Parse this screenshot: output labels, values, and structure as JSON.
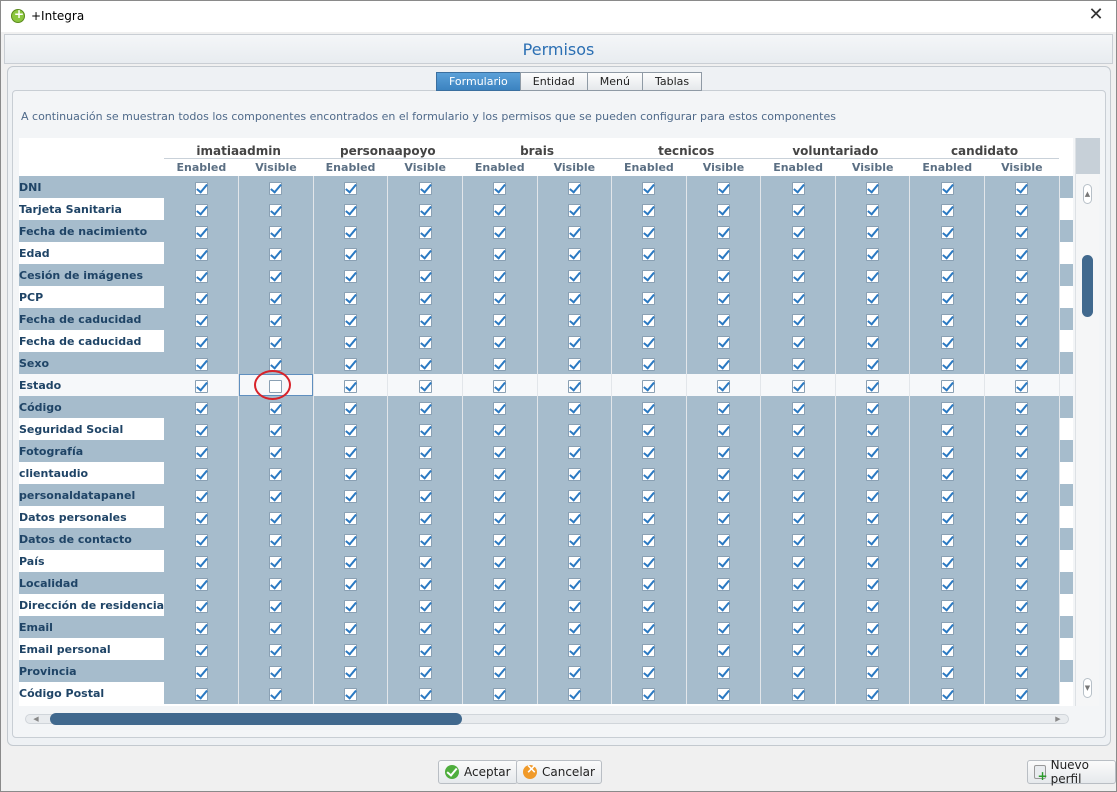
{
  "window": {
    "title": "+Integra",
    "close_glyph": "✕"
  },
  "page": {
    "title": "Permisos"
  },
  "tabs": [
    {
      "label": "Formulario",
      "active": true
    },
    {
      "label": "Entidad",
      "active": false
    },
    {
      "label": "Menú",
      "active": false
    },
    {
      "label": "Tablas",
      "active": false
    }
  ],
  "description": "A continuación se muestran todos los componentes encontrados en el formulario y los permisos que se pueden configurar para estos componentes",
  "permissions": {
    "sub_headers": [
      "Enabled",
      "Visible"
    ],
    "roles": [
      "imatiaadmin",
      "personaapoyo",
      "brais",
      "tecnicos",
      "voluntariado",
      "candidato"
    ],
    "components": [
      {
        "label": "DNI",
        "values": [
          true,
          true,
          true,
          true,
          true,
          true,
          true,
          true,
          true,
          true,
          true,
          true
        ]
      },
      {
        "label": "Tarjeta Sanitaria",
        "values": [
          true,
          true,
          true,
          true,
          true,
          true,
          true,
          true,
          true,
          true,
          true,
          true
        ]
      },
      {
        "label": "Fecha de nacimiento",
        "values": [
          true,
          true,
          true,
          true,
          true,
          true,
          true,
          true,
          true,
          true,
          true,
          true
        ]
      },
      {
        "label": "Edad",
        "values": [
          true,
          true,
          true,
          true,
          true,
          true,
          true,
          true,
          true,
          true,
          true,
          true
        ]
      },
      {
        "label": "Cesión de imágenes",
        "values": [
          true,
          true,
          true,
          true,
          true,
          true,
          true,
          true,
          true,
          true,
          true,
          true
        ]
      },
      {
        "label": "PCP",
        "values": [
          true,
          true,
          true,
          true,
          true,
          true,
          true,
          true,
          true,
          true,
          true,
          true
        ]
      },
      {
        "label": "Fecha de caducidad",
        "values": [
          true,
          true,
          true,
          true,
          true,
          true,
          true,
          true,
          true,
          true,
          true,
          true
        ]
      },
      {
        "label": "Fecha de caducidad",
        "values": [
          true,
          true,
          true,
          true,
          true,
          true,
          true,
          true,
          true,
          true,
          true,
          true
        ]
      },
      {
        "label": "Sexo",
        "values": [
          true,
          true,
          true,
          true,
          true,
          true,
          true,
          true,
          true,
          true,
          true,
          true
        ]
      },
      {
        "label": "Estado",
        "values": [
          true,
          false,
          true,
          true,
          true,
          true,
          true,
          true,
          true,
          true,
          true,
          true
        ],
        "selected": true
      },
      {
        "label": "Código",
        "values": [
          true,
          true,
          true,
          true,
          true,
          true,
          true,
          true,
          true,
          true,
          true,
          true
        ]
      },
      {
        "label": "Seguridad Social",
        "values": [
          true,
          true,
          true,
          true,
          true,
          true,
          true,
          true,
          true,
          true,
          true,
          true
        ]
      },
      {
        "label": "Fotografía",
        "values": [
          true,
          true,
          true,
          true,
          true,
          true,
          true,
          true,
          true,
          true,
          true,
          true
        ]
      },
      {
        "label": "clientaudio",
        "values": [
          true,
          true,
          true,
          true,
          true,
          true,
          true,
          true,
          true,
          true,
          true,
          true
        ]
      },
      {
        "label": "personaldatapanel",
        "values": [
          true,
          true,
          true,
          true,
          true,
          true,
          true,
          true,
          true,
          true,
          true,
          true
        ]
      },
      {
        "label": "Datos personales",
        "values": [
          true,
          true,
          true,
          true,
          true,
          true,
          true,
          true,
          true,
          true,
          true,
          true
        ]
      },
      {
        "label": "Datos de contacto",
        "values": [
          true,
          true,
          true,
          true,
          true,
          true,
          true,
          true,
          true,
          true,
          true,
          true
        ]
      },
      {
        "label": "País",
        "values": [
          true,
          true,
          true,
          true,
          true,
          true,
          true,
          true,
          true,
          true,
          true,
          true
        ]
      },
      {
        "label": "Localidad",
        "values": [
          true,
          true,
          true,
          true,
          true,
          true,
          true,
          true,
          true,
          true,
          true,
          true
        ]
      },
      {
        "label": "Dirección de residencia",
        "values": [
          true,
          true,
          true,
          true,
          true,
          true,
          true,
          true,
          true,
          true,
          true,
          true
        ]
      },
      {
        "label": "Email",
        "values": [
          true,
          true,
          true,
          true,
          true,
          true,
          true,
          true,
          true,
          true,
          true,
          true
        ]
      },
      {
        "label": "Email personal",
        "values": [
          true,
          true,
          true,
          true,
          true,
          true,
          true,
          true,
          true,
          true,
          true,
          true
        ]
      },
      {
        "label": "Provincia",
        "values": [
          true,
          true,
          true,
          true,
          true,
          true,
          true,
          true,
          true,
          true,
          true,
          true
        ]
      },
      {
        "label": "Código Postal",
        "values": [
          true,
          true,
          true,
          true,
          true,
          true,
          true,
          true,
          true,
          true,
          true,
          true
        ]
      }
    ]
  },
  "buttons": {
    "accept": "Aceptar",
    "cancel": "Cancelar",
    "new_profile": "Nuevo perfil"
  },
  "colors": {
    "accent": "#2b6fb3",
    "row_band": "#a6bccc",
    "highlight_circle": "#d8232a"
  }
}
